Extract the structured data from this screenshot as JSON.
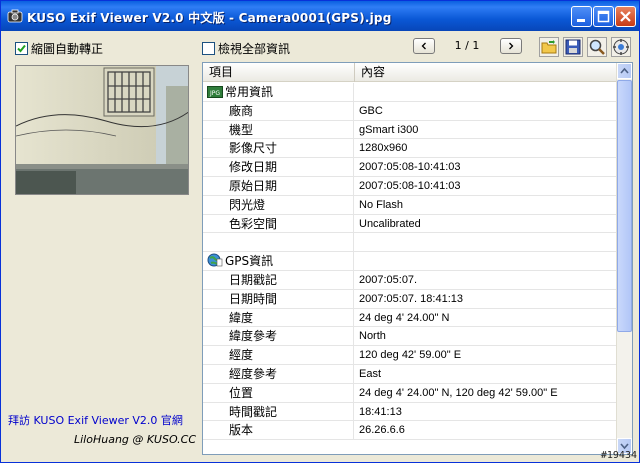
{
  "window": {
    "title": "KUSO Exif Viewer V2.0 中文版 - Camera0001(GPS).jpg"
  },
  "toolbar": {
    "auto_rotate": {
      "label": "縮圖自動轉正",
      "checked": true
    },
    "show_all": {
      "label": "檢視全部資訊",
      "checked": false
    },
    "page_indicator": "1 / 1",
    "prev_icon": "chevron-left-icon",
    "next_icon": "chevron-right-icon",
    "tools": [
      "open-folder-icon",
      "save-icon",
      "zoom-icon",
      "settings-icon"
    ]
  },
  "list": {
    "headers": {
      "item": "項目",
      "content": "內容"
    },
    "rows": [
      {
        "type": "group",
        "label": "常用資訊",
        "value": "",
        "icon": "jpg-icon"
      },
      {
        "type": "item",
        "label": "廠商",
        "value": "GBC"
      },
      {
        "type": "item",
        "label": "機型",
        "value": "gSmart i300"
      },
      {
        "type": "item",
        "label": "影像尺寸",
        "value": "1280x960"
      },
      {
        "type": "item",
        "label": "修改日期",
        "value": "2007:05:08-10:41:03"
      },
      {
        "type": "item",
        "label": "原始日期",
        "value": "2007:05:08-10:41:03"
      },
      {
        "type": "item",
        "label": "閃光燈",
        "value": "No Flash"
      },
      {
        "type": "item",
        "label": "色彩空間",
        "value": "Uncalibrated"
      },
      {
        "type": "blank",
        "label": "",
        "value": ""
      },
      {
        "type": "group",
        "label": "GPS資訊",
        "value": "",
        "icon": "globe-icon"
      },
      {
        "type": "item",
        "label": "日期戳記",
        "value": "2007:05:07."
      },
      {
        "type": "item",
        "label": "日期時間",
        "value": "2007:05:07. 18:41:13"
      },
      {
        "type": "item",
        "label": "緯度",
        "value": "24 deg 4' 24.00\" N"
      },
      {
        "type": "item",
        "label": "緯度參考",
        "value": "North"
      },
      {
        "type": "item",
        "label": "經度",
        "value": "120 deg 42' 59.00\" E"
      },
      {
        "type": "item",
        "label": "經度參考",
        "value": "East"
      },
      {
        "type": "item",
        "label": "位置",
        "value": "24 deg 4' 24.00\" N, 120 deg 42' 59.00\" E"
      },
      {
        "type": "item",
        "label": "時間戳記",
        "value": "18:41:13"
      },
      {
        "type": "item",
        "label": "版本",
        "value": "26.26.6.6"
      }
    ]
  },
  "footer": {
    "link": "拜訪 KUSO Exif Viewer V2.0 官網",
    "credit": "LiloHuang @ KUSO.CC"
  },
  "watermark": "#19434",
  "colors": {
    "titlebar": "#0a58d6",
    "link": "#0000cc",
    "list_border": "#7f9db9"
  }
}
